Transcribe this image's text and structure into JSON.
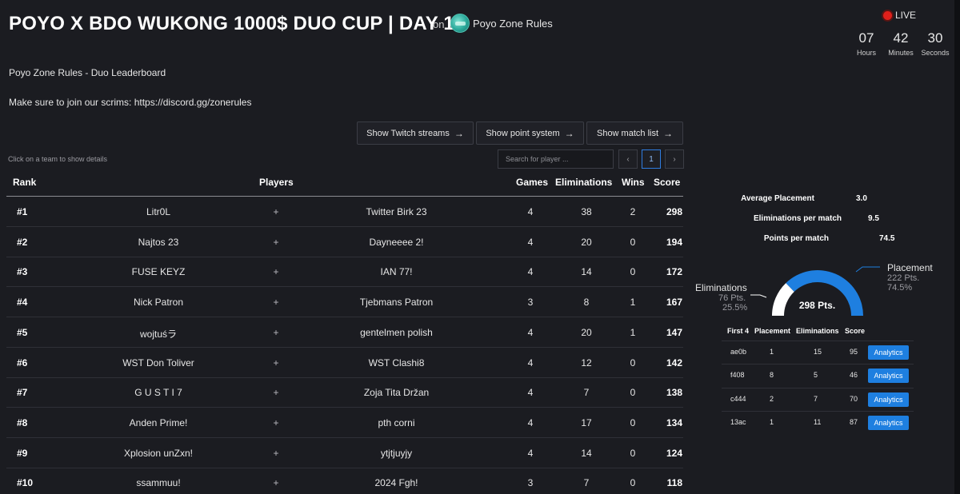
{
  "header": {
    "title": "POYO X BDO WUKONG 1000$ DUO CUP | DAY 1",
    "on": "on",
    "org_name": "Poyo Zone Rules",
    "live": "LIVE",
    "countdown": [
      {
        "value": "07",
        "label": "Hours"
      },
      {
        "value": "42",
        "label": "Minutes"
      },
      {
        "value": "30",
        "label": "Seconds"
      }
    ]
  },
  "subtitle": "Poyo Zone Rules - Duo Leaderboard",
  "scrims": "Make sure to join our scrims: https://discord.gg/zonerules",
  "buttons": {
    "twitch": "Show Twitch streams",
    "points": "Show point system",
    "matches": "Show match list",
    "arrow": "→"
  },
  "hint": "Click on a team to show details",
  "search": {
    "placeholder": "Search for player ..."
  },
  "pagination": {
    "prev": "‹",
    "current": "1",
    "next": "›"
  },
  "table": {
    "headers": {
      "rank": "Rank",
      "players": "Players",
      "games": "Games",
      "eliminations": "Eliminations",
      "wins": "Wins",
      "score": "Score"
    },
    "plus": "+",
    "rows": [
      {
        "rank": "#1",
        "p1": "Litr0L",
        "p2": "Twitter Birk 23",
        "games": "4",
        "elims": "38",
        "wins": "2",
        "score": "298"
      },
      {
        "rank": "#2",
        "p1": "Najtos 23",
        "p2": "Dayneeee 2!",
        "games": "4",
        "elims": "20",
        "wins": "0",
        "score": "194"
      },
      {
        "rank": "#3",
        "p1": "FUSE KEYZ",
        "p2": "IAN 77!",
        "games": "4",
        "elims": "14",
        "wins": "0",
        "score": "172"
      },
      {
        "rank": "#4",
        "p1": "Nick Patron",
        "p2": "Tjebmans Patron",
        "games": "3",
        "elims": "8",
        "wins": "1",
        "score": "167"
      },
      {
        "rank": "#5",
        "p1": "wojtuśラ",
        "p2": "gentelmen polish",
        "games": "4",
        "elims": "20",
        "wins": "1",
        "score": "147"
      },
      {
        "rank": "#6",
        "p1": "WST Don Toliver",
        "p2": "WST Clashi8",
        "games": "4",
        "elims": "12",
        "wins": "0",
        "score": "142"
      },
      {
        "rank": "#7",
        "p1": "G U S T I 7",
        "p2": "Zoja Tita Držan",
        "games": "4",
        "elims": "7",
        "wins": "0",
        "score": "138"
      },
      {
        "rank": "#8",
        "p1": "Anden Prime!",
        "p2": "pth corni",
        "games": "4",
        "elims": "17",
        "wins": "0",
        "score": "134"
      },
      {
        "rank": "#9",
        "p1": "Xplosion unZxn!",
        "p2": "ytjtjuyjy",
        "games": "4",
        "elims": "14",
        "wins": "0",
        "score": "124"
      },
      {
        "rank": "#10",
        "p1": "ssammuu!",
        "p2": "2024 Fgh!",
        "games": "3",
        "elims": "7",
        "wins": "0",
        "score": "118"
      }
    ]
  },
  "details": {
    "stats": [
      {
        "label": "Average Placement",
        "value": "3.0"
      },
      {
        "label": "Eliminations per match",
        "value": "9.5"
      },
      {
        "label": "Points per match",
        "value": "74.5"
      }
    ],
    "donut": {
      "total": "298 Pts.",
      "eliminations": {
        "label": "Eliminations",
        "pts": "76 Pts.",
        "pct": "25.5%",
        "fraction": 0.255,
        "color": "#ffffff"
      },
      "placement": {
        "label": "Placement",
        "pts": "222 Pts.",
        "pct": "74.5%",
        "fraction": 0.745,
        "color": "#1e7fe0"
      }
    },
    "matches": {
      "headers": {
        "id": "First 4",
        "placement": "Placement",
        "eliminations": "Eliminations",
        "score": "Score"
      },
      "button": "Analytics",
      "rows": [
        {
          "id": "ae0b",
          "placement": "1",
          "elims": "15",
          "score": "95"
        },
        {
          "id": "f408",
          "placement": "8",
          "elims": "5",
          "score": "46"
        },
        {
          "id": "c444",
          "placement": "2",
          "elims": "7",
          "score": "70"
        },
        {
          "id": "13ac",
          "placement": "1",
          "elims": "11",
          "score": "87"
        }
      ]
    }
  }
}
